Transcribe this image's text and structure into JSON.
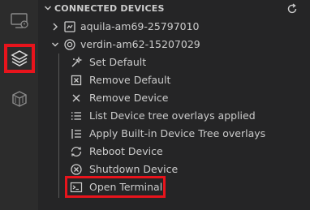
{
  "sidebar": {
    "title": "CONNECTED DEVICES",
    "devices": [
      {
        "name": "aquila-am69-25797010",
        "expanded": false,
        "icon": "device-board-icon"
      },
      {
        "name": "verdin-am62-15207029",
        "expanded": true,
        "icon": "target-icon"
      }
    ],
    "actions": [
      {
        "label": "Set Default",
        "icon": "wand-icon"
      },
      {
        "label": "Remove Default",
        "icon": "remove-default-icon"
      },
      {
        "label": "Remove Device",
        "icon": "close-icon"
      },
      {
        "label": "List Device tree overlays applied",
        "icon": "list-icon"
      },
      {
        "label": "Apply Built-in Device Tree overlays",
        "icon": "list-indent-icon"
      },
      {
        "label": "Reboot Device",
        "icon": "reboot-icon"
      },
      {
        "label": "Shutdown Device",
        "icon": "shutdown-icon"
      },
      {
        "label": "Open Terminal",
        "icon": "terminal-icon"
      }
    ]
  },
  "activity_bar": {
    "items": [
      "remote-explorer-icon",
      "torizon-icon",
      "docker-icon"
    ],
    "selected": "torizon-icon"
  },
  "colors": {
    "highlight": "#e8141c",
    "background": "#252526",
    "activity_bar": "#2c2c2c",
    "text": "#cccccc"
  }
}
